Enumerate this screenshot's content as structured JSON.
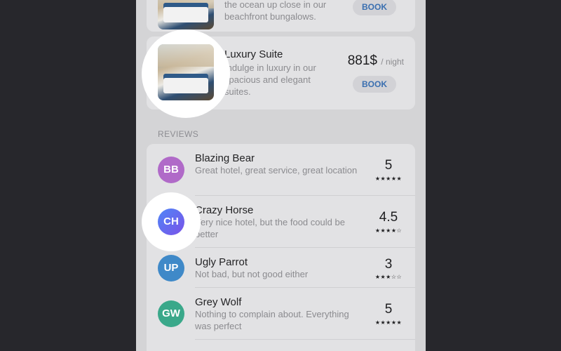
{
  "rooms": [
    {
      "desc_partial": "the ocean up close in our beachfront bungalows.",
      "book_label": "BOOK"
    },
    {
      "title": "Luxury Suite",
      "desc": "Indulge in luxury in our spacious and elegant suites.",
      "price": "881$",
      "unit": "/ night",
      "book_label": "BOOK"
    }
  ],
  "reviews_header": "REVIEWS",
  "reviews": [
    {
      "initials": "BB",
      "name": "Blazing Bear",
      "comment": "Great hotel, great service, great location",
      "score": "5",
      "stars": "★★★★★",
      "color": "#b06ac8"
    },
    {
      "initials": "CH",
      "name": "Crazy Horse",
      "comment": "Very nice hotel, but the food could be better",
      "score": "4.5",
      "stars": "★★★★☆",
      "color": "#5a6cf0"
    },
    {
      "initials": "UP",
      "name": "Ugly Parrot",
      "comment": "Not bad, but not good either",
      "score": "3",
      "stars": "★★★☆☆",
      "color": "#3f89c8"
    },
    {
      "initials": "GW",
      "name": "Grey Wolf",
      "comment": "Nothing to complain about. Everything was perfect",
      "score": "5",
      "stars": "★★★★★",
      "color": "#3aa88a"
    }
  ]
}
